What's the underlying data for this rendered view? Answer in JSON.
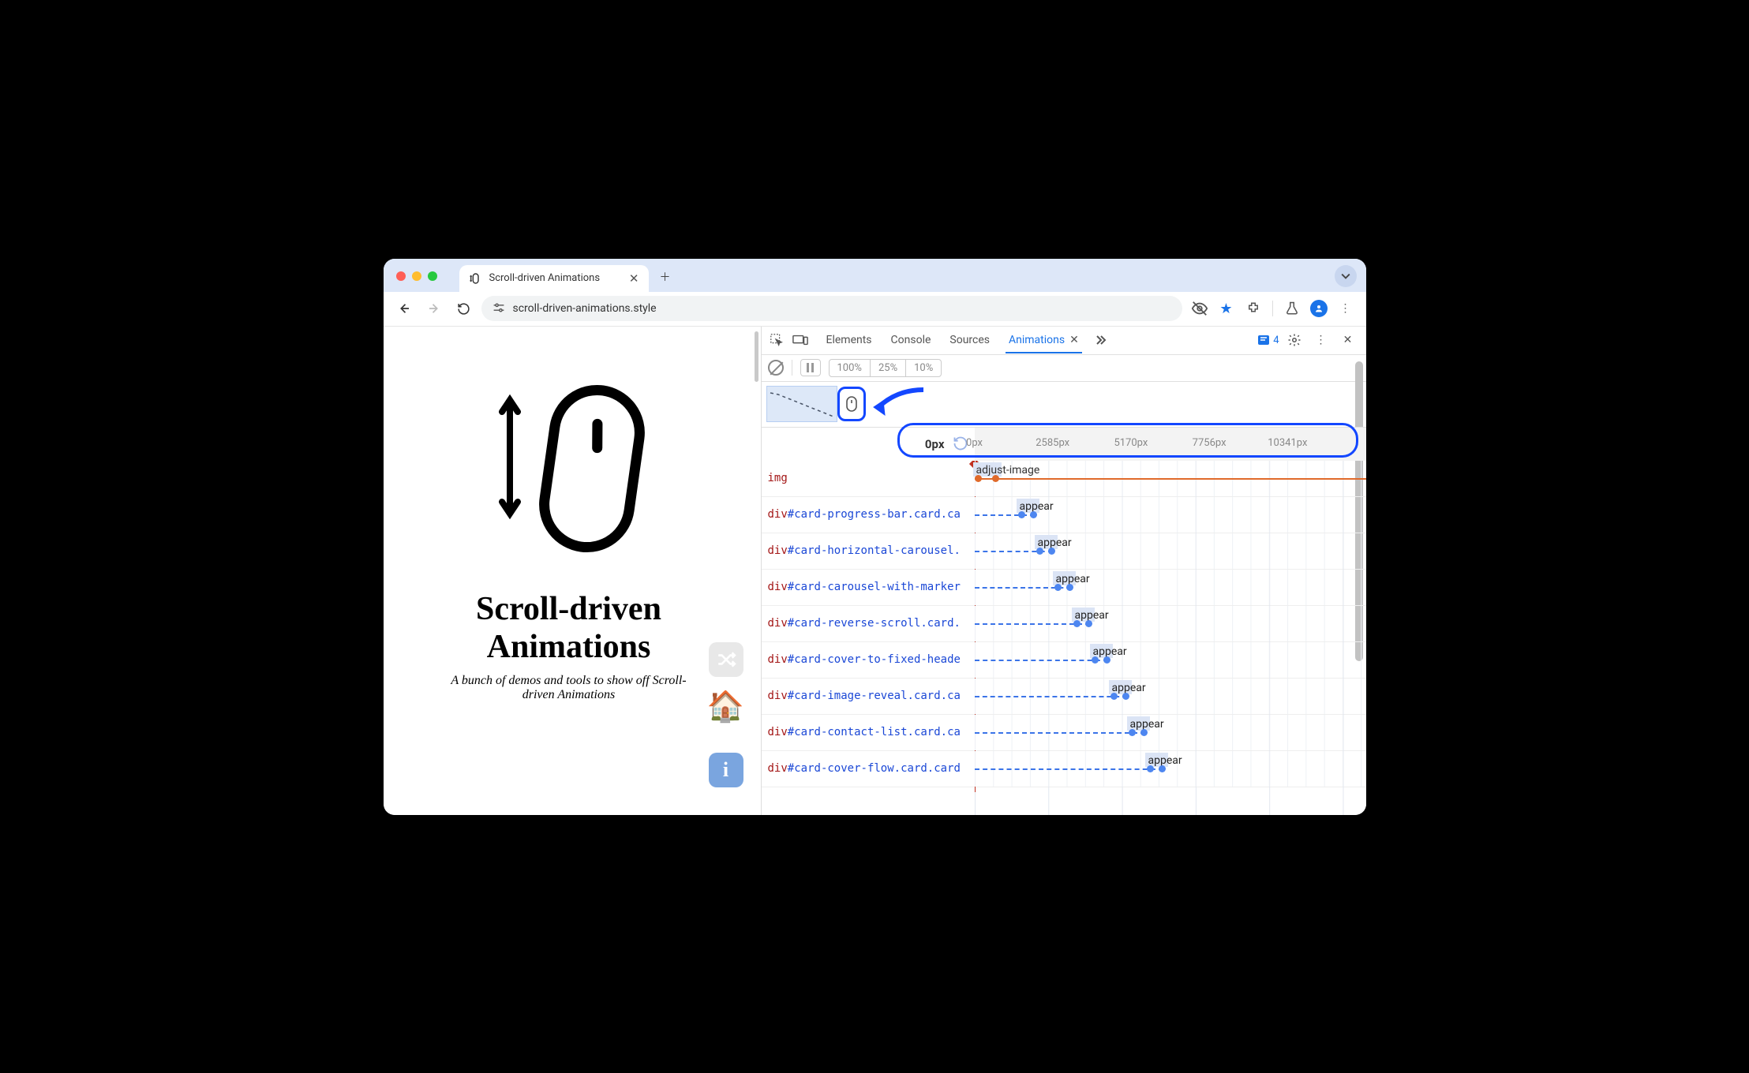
{
  "tabstrip": {
    "tab_title": "Scroll-driven Animations"
  },
  "toolbar": {
    "url": "scroll-driven-animations.style"
  },
  "page": {
    "title_line1": "Scroll-driven",
    "title_line2": "Animations",
    "subtitle": "A bunch of demos and tools to show off Scroll-driven Animations",
    "info_label": "i"
  },
  "devtools": {
    "tabs": {
      "elements": "Elements",
      "console": "Console",
      "sources": "Sources",
      "animations": "Animations"
    },
    "issue_count": "4",
    "speeds": {
      "s100": "100%",
      "s25": "25%",
      "s10": "10%"
    },
    "ruler": {
      "current": "0px",
      "ticks": [
        "0px",
        "2585px",
        "5170px",
        "7756px",
        "10341px"
      ]
    },
    "tracks": [
      {
        "tag": "img",
        "sel": "",
        "anim": "adjust-image",
        "start": 0,
        "kf1": 0,
        "kf2": 22,
        "accent": true
      },
      {
        "tag": "div",
        "sel": "#card-progress-bar.card.ca",
        "anim": "appear",
        "start": 55,
        "kf1": 55,
        "kf2": 70
      },
      {
        "tag": "div",
        "sel": "#card-horizontal-carousel.",
        "anim": "appear",
        "start": 78,
        "kf1": 78,
        "kf2": 93
      },
      {
        "tag": "div",
        "sel": "#card-carousel-with-marker",
        "anim": "appear",
        "start": 101,
        "kf1": 101,
        "kf2": 116
      },
      {
        "tag": "div",
        "sel": "#card-reverse-scroll.card.",
        "anim": "appear",
        "start": 125,
        "kf1": 125,
        "kf2": 140
      },
      {
        "tag": "div",
        "sel": "#card-cover-to-fixed-heade",
        "anim": "appear",
        "start": 148,
        "kf1": 148,
        "kf2": 163
      },
      {
        "tag": "div",
        "sel": "#card-image-reveal.card.ca",
        "anim": "appear",
        "start": 172,
        "kf1": 172,
        "kf2": 187
      },
      {
        "tag": "div",
        "sel": "#card-contact-list.card.ca",
        "anim": "appear",
        "start": 195,
        "kf1": 195,
        "kf2": 210
      },
      {
        "tag": "div",
        "sel": "#card-cover-flow.card.card",
        "anim": "appear",
        "start": 218,
        "kf1": 218,
        "kf2": 233
      }
    ]
  }
}
